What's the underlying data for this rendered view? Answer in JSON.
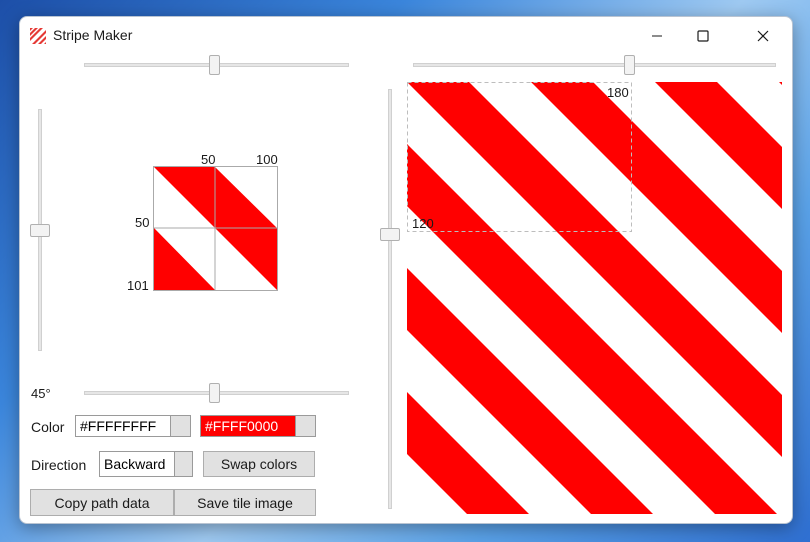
{
  "window": {
    "title": "Stripe Maker"
  },
  "tile": {
    "label_x1": "50",
    "label_x2": "100",
    "label_y1": "50",
    "label_y2": "101"
  },
  "angle": {
    "label": "45°"
  },
  "color": {
    "label": "Color",
    "color1": "#FFFFFFFF",
    "color2": "#FFFF0000"
  },
  "direction": {
    "label": "Direction",
    "value": "Backward"
  },
  "buttons": {
    "swap": "Swap colors",
    "copy": "Copy path data",
    "save": "Save tile image"
  },
  "preview": {
    "marker_x": "180",
    "marker_y": "120"
  },
  "colors": {
    "stripe": "#FF0000",
    "background": "#FFFFFF"
  }
}
